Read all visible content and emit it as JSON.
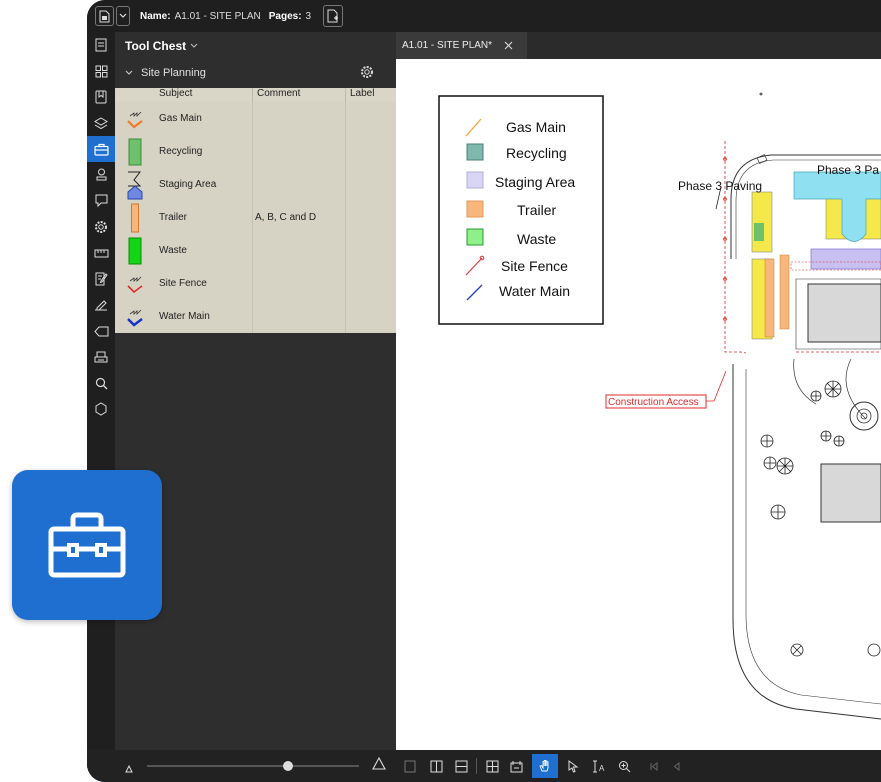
{
  "topbar": {
    "name_label": "Name:",
    "name_value": "A1.01 - SITE PLAN",
    "pages_label": "Pages:",
    "pages_value": "3"
  },
  "panel": {
    "title": "Tool Chest",
    "set_name": "Site Planning",
    "columns": [
      "Subject",
      "Comment",
      "Label"
    ],
    "tools": [
      {
        "subject": "Gas Main",
        "comment": "",
        "icon": "gas-main-icon"
      },
      {
        "subject": "Recycling",
        "comment": "",
        "icon": "recycling-icon"
      },
      {
        "subject": "Staging Area",
        "comment": "",
        "icon": "staging-area-icon"
      },
      {
        "subject": "Trailer",
        "comment": "A, B, C and D",
        "icon": "trailer-icon"
      },
      {
        "subject": "Waste",
        "comment": "",
        "icon": "waste-icon"
      },
      {
        "subject": "Site Fence",
        "comment": "",
        "icon": "site-fence-icon"
      },
      {
        "subject": "Water Main",
        "comment": "",
        "icon": "water-main-icon"
      }
    ]
  },
  "doc": {
    "tab_title": "A1.01 - SITE PLAN*"
  },
  "legend": {
    "items": [
      {
        "label": "Gas Main",
        "color": "#f5a53a"
      },
      {
        "label": "Recycling",
        "color": "#7fb8ae"
      },
      {
        "label": "Staging Area",
        "color": "#d9d6f5"
      },
      {
        "label": "Trailer",
        "color": "#f7b77c"
      },
      {
        "label": "Waste",
        "color": "#8ef08a"
      },
      {
        "label": "Site Fence",
        "color": "#e23a3a"
      },
      {
        "label": "Water Main",
        "color": "#1d3fc9"
      }
    ]
  },
  "plan": {
    "label_paving_left": "Phase 3 Paving",
    "label_paving_right": "Phase 3 Pa",
    "label_access": "Construction Access"
  },
  "colors": {
    "accent": "#1e6fcf",
    "panel_bg": "#2e2e2e",
    "table_bg": "#d6d3c4"
  }
}
